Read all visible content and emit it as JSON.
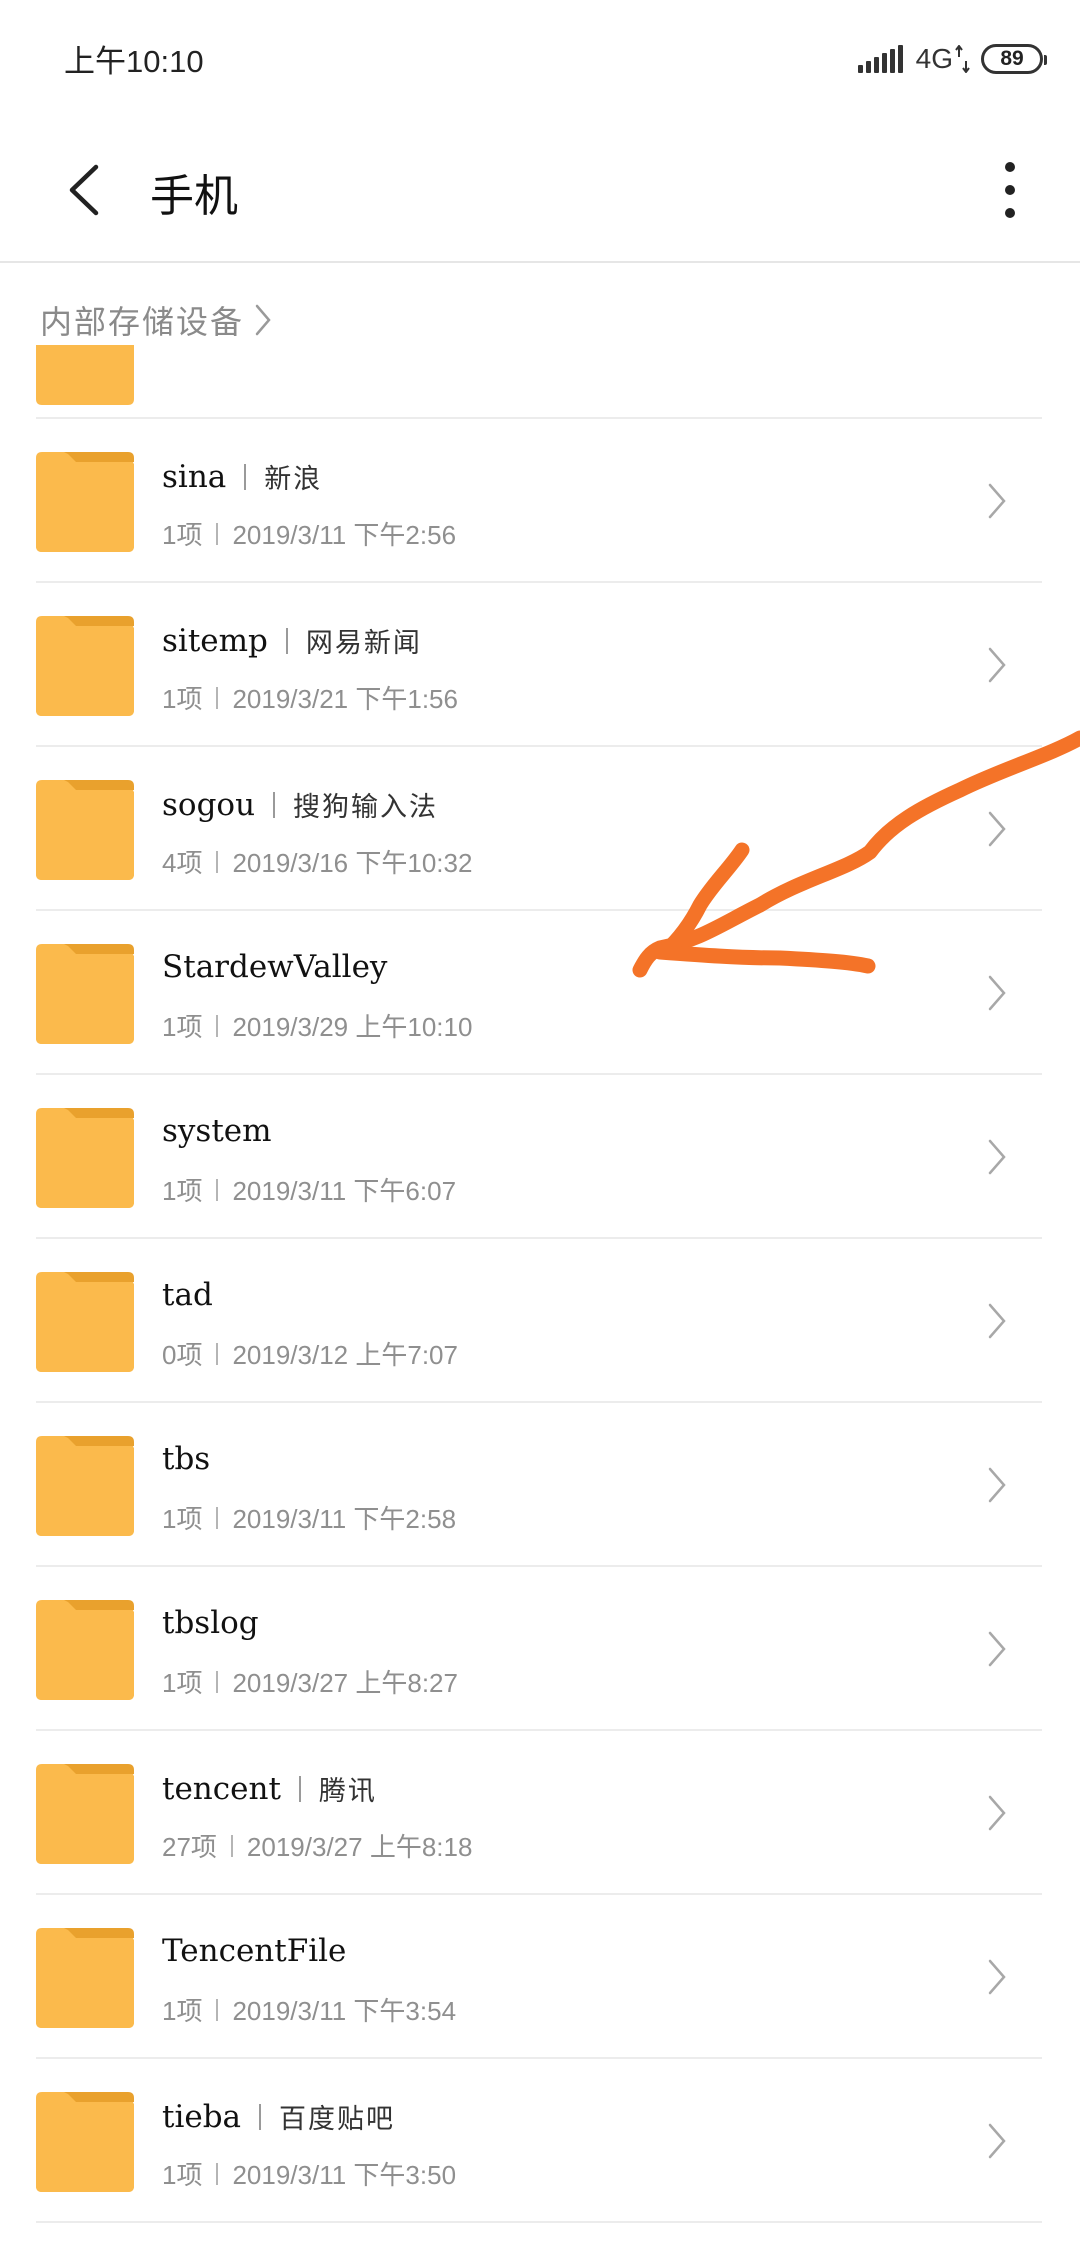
{
  "status_bar": {
    "time": "上午10:10",
    "network": "4G",
    "battery": "89"
  },
  "header": {
    "title": "手机"
  },
  "breadcrumb": {
    "path": "内部存储设备"
  },
  "folders": [
    {
      "name": "sina",
      "alias": "新浪",
      "count": "1项",
      "date": "2019/3/11 下午2:56"
    },
    {
      "name": "sitemp",
      "alias": "网易新闻",
      "count": "1项",
      "date": "2019/3/21 下午1:56"
    },
    {
      "name": "sogou",
      "alias": "搜狗输入法",
      "count": "4项",
      "date": "2019/3/16 下午10:32"
    },
    {
      "name": "StardewValley",
      "alias": "",
      "count": "1项",
      "date": "2019/3/29 上午10:10"
    },
    {
      "name": "system",
      "alias": "",
      "count": "1项",
      "date": "2019/3/11 下午6:07"
    },
    {
      "name": "tad",
      "alias": "",
      "count": "0项",
      "date": "2019/3/12 上午7:07"
    },
    {
      "name": "tbs",
      "alias": "",
      "count": "1项",
      "date": "2019/3/11 下午2:58"
    },
    {
      "name": "tbslog",
      "alias": "",
      "count": "1项",
      "date": "2019/3/27 上午8:27"
    },
    {
      "name": "tencent",
      "alias": "腾讯",
      "count": "27项",
      "date": "2019/3/27 上午8:18"
    },
    {
      "name": "TencentFile",
      "alias": "",
      "count": "1项",
      "date": "2019/3/11 下午3:54"
    },
    {
      "name": "tieba",
      "alias": "百度贴吧",
      "count": "1项",
      "date": "2019/3/11 下午3:50"
    }
  ],
  "colors": {
    "folder": "#FBBA4C",
    "folder_tab": "#E9A12D",
    "annotation_stroke": "#F47328"
  }
}
